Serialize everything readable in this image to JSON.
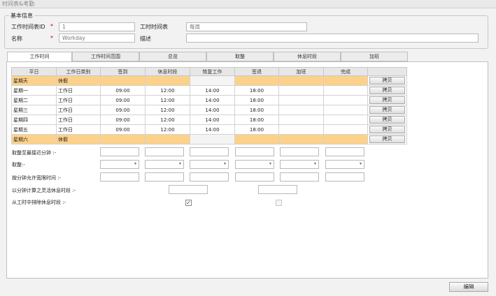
{
  "window": {
    "title": "时间表&考勤"
  },
  "basic_info": {
    "legend": "基本信息",
    "schedule_id": {
      "label": "工作时间表ID",
      "required_mark": "*",
      "value": "1"
    },
    "schedule": {
      "label": "工时时间表",
      "value": "每周"
    },
    "name": {
      "label": "名称",
      "required_mark": "*",
      "value": "Workday"
    },
    "description": {
      "label": "描述",
      "value": ""
    }
  },
  "tabs": [
    "工作时间",
    "工作时间范围",
    "总览",
    "取整",
    "休息时段",
    "加班"
  ],
  "active_tab": 0,
  "grid": {
    "columns": [
      "平日",
      "工作日类别",
      "签到",
      "休息时段",
      "恢复工作",
      "签退",
      "加班",
      "完成",
      ""
    ],
    "rows": [
      {
        "day": "星期天",
        "type": "休假",
        "checkin": "",
        "break": "",
        "resume": "",
        "checkout": "",
        "overtime": "",
        "done": "",
        "action": "拷贝",
        "rest": true
      },
      {
        "day": "星期一",
        "type": "工作日",
        "checkin": "09:00",
        "break": "12:00",
        "resume": "14:00",
        "checkout": "18:00",
        "overtime": "",
        "done": "",
        "action": "拷贝",
        "rest": false
      },
      {
        "day": "星期二",
        "type": "工作日",
        "checkin": "09:00",
        "break": "12:00",
        "resume": "14:00",
        "checkout": "18:00",
        "overtime": "",
        "done": "",
        "action": "拷贝",
        "rest": false
      },
      {
        "day": "星期三",
        "type": "工作日",
        "checkin": "09:00",
        "break": "12:00",
        "resume": "14:00",
        "checkout": "18:00",
        "overtime": "",
        "done": "",
        "action": "拷贝",
        "rest": false
      },
      {
        "day": "星期四",
        "type": "工作日",
        "checkin": "09:00",
        "break": "12:00",
        "resume": "14:00",
        "checkout": "18:00",
        "overtime": "",
        "done": "",
        "action": "拷贝",
        "rest": false
      },
      {
        "day": "星期五",
        "type": "工作日",
        "checkin": "09:00",
        "break": "12:00",
        "resume": "14:00",
        "checkout": "18:00",
        "overtime": "",
        "done": "",
        "action": "拷贝",
        "rest": false
      },
      {
        "day": "星期六",
        "type": "休假",
        "checkin": "",
        "break": "",
        "resume": "",
        "checkout": "",
        "overtime": "",
        "done": "",
        "action": "拷贝",
        "rest": true
      }
    ]
  },
  "settings": {
    "round_minutes_label": "取整至最接近分钟 :-",
    "rounding_label": "取整:-",
    "grace_label": "按分钟允许宽限时间 :-",
    "flex_break_label": "以分钟计算之灵活休息时段 :-",
    "exclude_break_label": "从工时中排除休息时段 :-",
    "exclude_break_checked": true,
    "exclude_break_second_checked": false
  },
  "footer": {
    "edit_label": "编辑"
  },
  "colors": {
    "rest_row": "#fcd28a",
    "required": "#cc0000"
  }
}
